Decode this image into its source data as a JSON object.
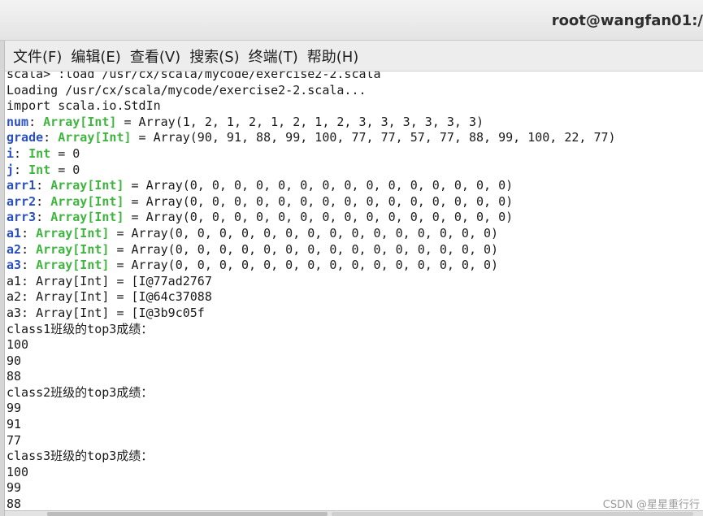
{
  "window": {
    "title": "root@wangfan01:/"
  },
  "menu": {
    "items": [
      "文件(F)",
      "编辑(E)",
      "查看(V)",
      "搜索(S)",
      "终端(T)",
      "帮助(H)"
    ]
  },
  "terminal": {
    "lines": [
      "scala> :load /usr/cx/scala/mycode/exercise2-2.scala",
      "Loading /usr/cx/scala/mycode/exercise2-2.scala...",
      "import scala.io.StdIn",
      {
        "v": "num",
        "t": "Array[Int]",
        "r": " = Array(1, 2, 1, 2, 1, 2, 1, 2, 3, 3, 3, 3, 3, 3)"
      },
      {
        "v": "grade",
        "t": "Array[Int]",
        "r": " = Array(90, 91, 88, 99, 100, 77, 77, 57, 77, 88, 99, 100, 22, 77)"
      },
      {
        "v": "i",
        "t": "Int",
        "r": " = 0"
      },
      {
        "v": "j",
        "t": "Int",
        "r": " = 0"
      },
      {
        "v": "arr1",
        "t": "Array[Int]",
        "r": " = Array(0, 0, 0, 0, 0, 0, 0, 0, 0, 0, 0, 0, 0, 0, 0)"
      },
      {
        "v": "arr2",
        "t": "Array[Int]",
        "r": " = Array(0, 0, 0, 0, 0, 0, 0, 0, 0, 0, 0, 0, 0, 0, 0)"
      },
      {
        "v": "arr3",
        "t": "Array[Int]",
        "r": " = Array(0, 0, 0, 0, 0, 0, 0, 0, 0, 0, 0, 0, 0, 0, 0)"
      },
      {
        "v": "a1",
        "t": "Array[Int]",
        "r": " = Array(0, 0, 0, 0, 0, 0, 0, 0, 0, 0, 0, 0, 0, 0, 0)"
      },
      {
        "v": "a2",
        "t": "Array[Int]",
        "r": " = Array(0, 0, 0, 0, 0, 0, 0, 0, 0, 0, 0, 0, 0, 0, 0)"
      },
      {
        "v": "a3",
        "t": "Array[Int]",
        "r": " = Array(0, 0, 0, 0, 0, 0, 0, 0, 0, 0, 0, 0, 0, 0, 0)"
      },
      "a1: Array[Int] = [I@77ad2767",
      "a2: Array[Int] = [I@64c37088",
      "a3: Array[Int] = [I@3b9c05f",
      "class1班级的top3成绩：",
      "100",
      "90",
      "88",
      "class2班级的top3成绩：",
      "99",
      "91",
      "77",
      "class3班级的top3成绩：",
      "100",
      "99",
      "88"
    ]
  },
  "watermark": "CSDN @星星重行行"
}
